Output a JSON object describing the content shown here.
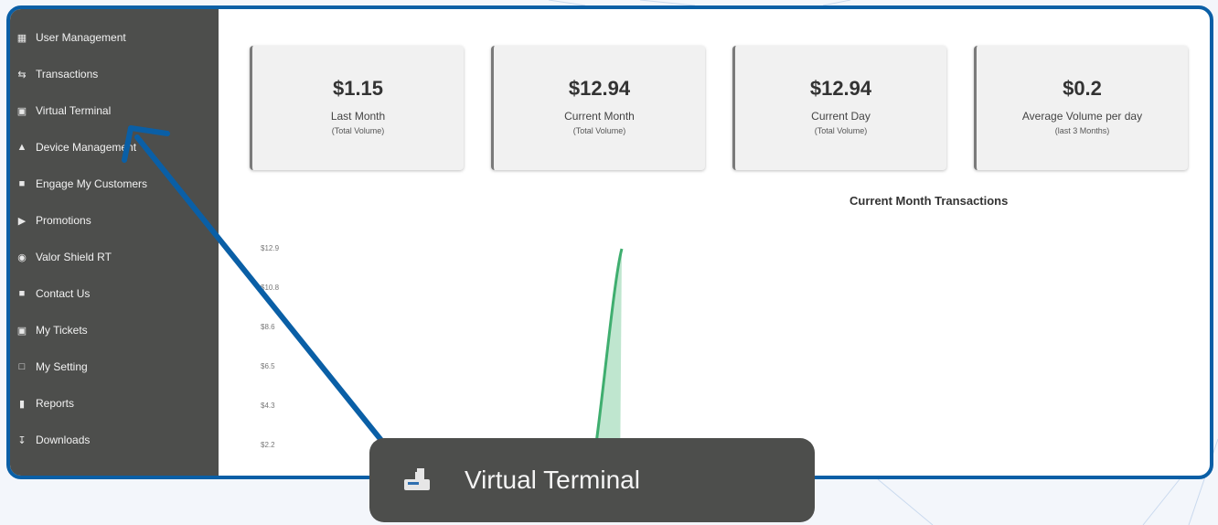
{
  "sidebar": {
    "items": [
      {
        "label": "User Management",
        "icon": "users-icon"
      },
      {
        "label": "Transactions",
        "icon": "transfer-icon"
      },
      {
        "label": "Virtual Terminal",
        "icon": "terminal-icon"
      },
      {
        "label": "Device Management",
        "icon": "device-icon"
      },
      {
        "label": "Engage My Customers",
        "icon": "engage-icon"
      },
      {
        "label": "Promotions",
        "icon": "promotion-icon"
      },
      {
        "label": "Valor Shield RT",
        "icon": "shield-icon"
      },
      {
        "label": "Contact Us",
        "icon": "contact-icon"
      },
      {
        "label": "My Tickets",
        "icon": "ticket-icon"
      },
      {
        "label": "My Setting",
        "icon": "settings-icon"
      },
      {
        "label": "Reports",
        "icon": "report-icon"
      },
      {
        "label": "Downloads",
        "icon": "download-icon"
      }
    ]
  },
  "cards": [
    {
      "value": "$1.15",
      "label": "Last Month",
      "sub": "(Total Volume)"
    },
    {
      "value": "$12.94",
      "label": "Current Month",
      "sub": "(Total Volume)"
    },
    {
      "value": "$12.94",
      "label": "Current Day",
      "sub": "(Total Volume)"
    },
    {
      "value": "$0.2",
      "label": "Average Volume per day",
      "sub": "(last 3 Months)"
    }
  ],
  "chart_data": {
    "type": "area",
    "title": "Current Month Transactions",
    "yticks": [
      "$12.9",
      "$10.8",
      "$8.6",
      "$6.5",
      "$4.3",
      "$2.2"
    ],
    "series": [
      {
        "values": [
          0,
          0,
          12.94
        ]
      }
    ],
    "color": "#3fae6f"
  },
  "popup": {
    "label": "Virtual Terminal",
    "icon": "terminal-icon"
  },
  "colors": {
    "frame": "#0a5fa6",
    "sidebar": "#4d4e4c",
    "arrow": "#0a5fa6"
  }
}
